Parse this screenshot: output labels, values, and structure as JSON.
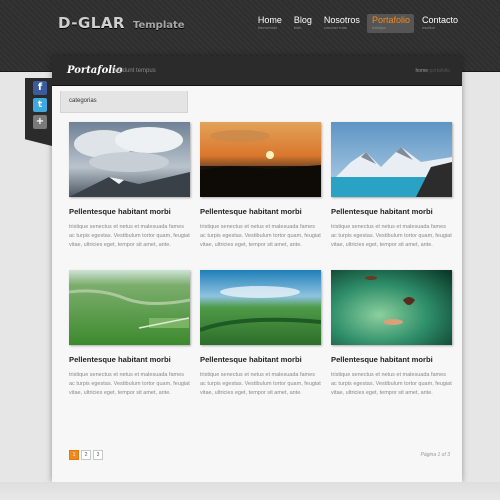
{
  "header": {
    "logo": "D-GLAR",
    "logo_sub": "Template",
    "nav": [
      {
        "label": "Home",
        "desc": "bienvenido",
        "active": false
      },
      {
        "label": "Blog",
        "desc": "blah",
        "active": false
      },
      {
        "label": "Nosotros",
        "desc": "conocer mas",
        "active": false
      },
      {
        "label": "Portafolio",
        "desc": "trabajos",
        "active": true
      },
      {
        "label": "Contacto",
        "desc": "escribe",
        "active": false
      }
    ],
    "accent": "#f08a1c"
  },
  "title_bar": {
    "title": "Portafolio",
    "tagline": "tincidunt tempus",
    "crumb_home": "home",
    "crumb_current": "portafolio"
  },
  "social": {
    "facebook": "f",
    "twitter": "t",
    "more": "+"
  },
  "category_label": "categorias",
  "items": [
    {
      "title": "Pellentesque habitant morbi",
      "text": "tristique senectus et netus et malesuada fames ac turpis egestas. Vestibulum tortor quam, feugiat vitae, ultricies eget, tempor sit amet, ante.",
      "image": "cloudy-mountain"
    },
    {
      "title": "Pellentesque habitant morbi",
      "text": "tristique senectus et netus et malesuada fames ac turpis egestas. Vestibulum tortor quam, feugiat vitae, ultricies eget, tempor sit amet, ante.",
      "image": "sunset"
    },
    {
      "title": "Pellentesque habitant morbi",
      "text": "tristique senectus et netus et malesuada fames ac turpis egestas. Vestibulum tortor quam, feugiat vitae, ultricies eget, tempor sit amet, ante.",
      "image": "snowy-lake"
    },
    {
      "title": "Pellentesque habitant morbi",
      "text": "tristique senectus et netus et malesuada fames ac turpis egestas. Vestibulum tortor quam, feugiat vitae, ultricies eget, tempor sit amet, ante.",
      "image": "green-valley"
    },
    {
      "title": "Pellentesque habitant morbi",
      "text": "tristique senectus et netus et malesuada fames ac turpis egestas. Vestibulum tortor quam, feugiat vitae, ultricies eget, tempor sit amet, ante.",
      "image": "aerial-fields"
    },
    {
      "title": "Pellentesque habitant morbi",
      "text": "tristique senectus et netus et malesuada fames ac turpis egestas. Vestibulum tortor quam, feugiat vitae, ultricies eget, tempor sit amet, ante.",
      "image": "green-abstract"
    }
  ],
  "pagination": {
    "pages": [
      "1",
      "2",
      "3"
    ],
    "current": "1",
    "summary": "Página 1 of 3"
  }
}
